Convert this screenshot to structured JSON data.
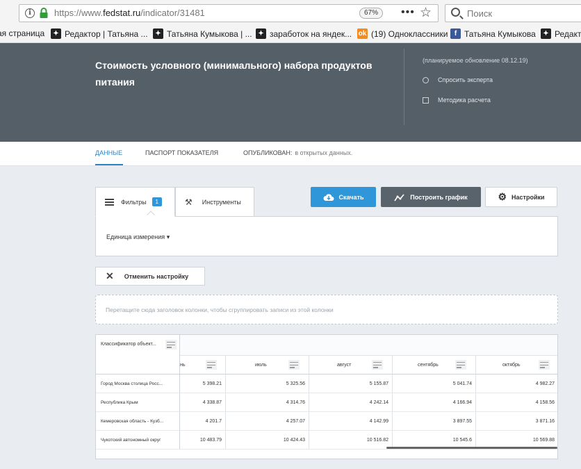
{
  "browser": {
    "url_prefix": "https://www.",
    "url_domain": "fedstat.ru",
    "url_path": "/indicator/31481",
    "zoom": "67%",
    "search_placeholder": "Поиск",
    "bookmarks": [
      {
        "label": "ая страница",
        "icon": "none"
      },
      {
        "label": "Редактор | Татьяна ...",
        "icon": "sparkle-icon"
      },
      {
        "label": "Татьяна Кумыкова | ...",
        "icon": "sparkle-icon"
      },
      {
        "label": "заработок на яндек...",
        "icon": "sparkle-icon"
      },
      {
        "label": "(19) Одноклассники",
        "icon": "odnoklassniki-icon"
      },
      {
        "label": "Татьяна Кумыкова",
        "icon": "facebook-icon"
      },
      {
        "label": "Редакт",
        "icon": "sparkle-icon"
      }
    ]
  },
  "header": {
    "title": "Стоимость условного (минимального) набора продуктов питания",
    "update_note": "(планируемое обновление 08.12.19)",
    "ask_expert": "Спросить эксперта",
    "methodology": "Методика расчета"
  },
  "tabs": {
    "data": "ДАННЫЕ",
    "passport": "ПАСПОРТ ПОКАЗАТЕЛЯ",
    "published": "ОПУБЛИКОВАН:",
    "published_value": "в открытых данных."
  },
  "toolbar": {
    "filters": "Фильтры",
    "filters_count": "1",
    "tools": "Инструменты",
    "download": "Скачать",
    "build_chart": "Построить график",
    "settings": "Настройки"
  },
  "filters": {
    "unit": "Единица измерения"
  },
  "reset": "Отменить настройку",
  "group_hint": "Перетащите сюда заголовок колонки, чтобы сгруппировать записи из этой колонки",
  "grid": {
    "classifier_header": "Классификатор объект...",
    "columns": [
      "нь",
      "июль",
      "август",
      "сентябрь",
      "октябрь"
    ],
    "rows": [
      {
        "label": "Город Москва столица Росс...",
        "values": [
          "5 398.21",
          "5 325.56",
          "5 155.87",
          "5 041.74",
          "4 982.27"
        ]
      },
      {
        "label": "Республика Крым",
        "values": [
          "4 338.87",
          "4 314.76",
          "4 242.14",
          "4 166.94",
          "4 158.56"
        ]
      },
      {
        "label": "Кемеровская область - Кузб...",
        "values": [
          "4 201.7",
          "4 257.07",
          "4 142.99",
          "3 897.55",
          "3 871.16"
        ]
      },
      {
        "label": "Чукотский автономный округ",
        "values": [
          "10 483.79",
          "10 424.43",
          "10 516.82",
          "10 545.6",
          "10 569.88"
        ]
      }
    ]
  },
  "colors": {
    "header_bg": "#555f68",
    "accent": "#2f97d9",
    "chart_button": "#59636c"
  }
}
